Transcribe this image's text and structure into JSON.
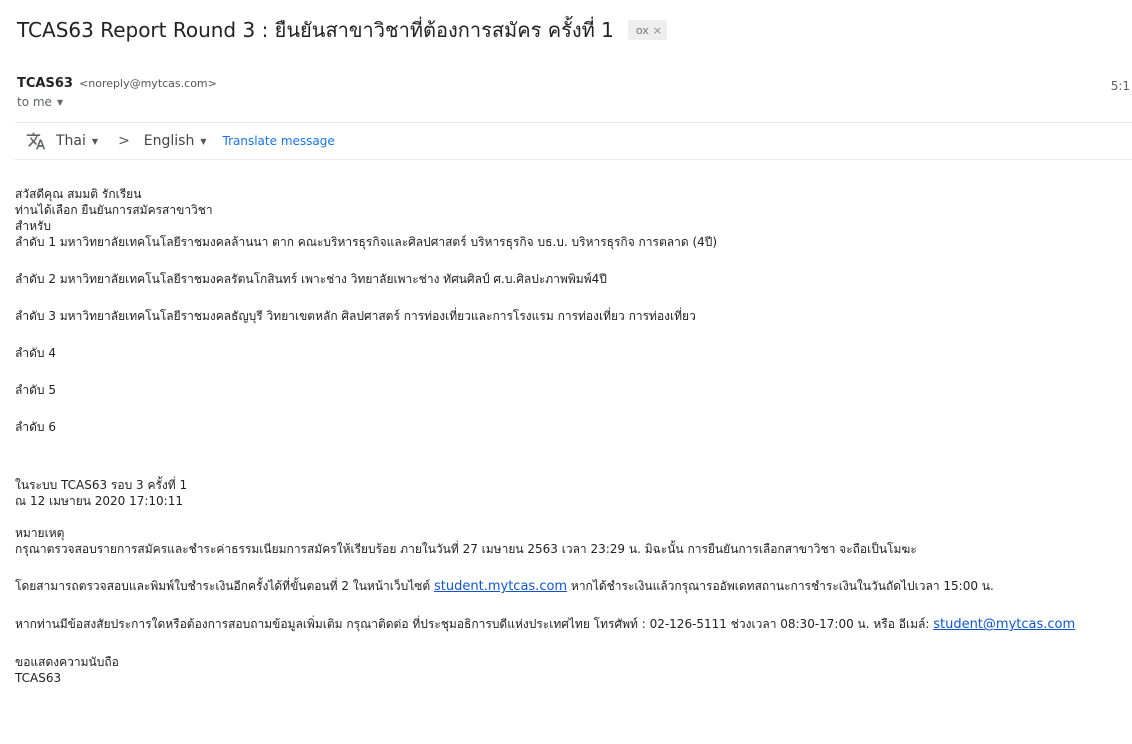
{
  "subject": {
    "title": "TCAS63 Report Round 3 : ยืนยันสาขาวิชาที่ต้องการสมัคร ครั้งที่ 1",
    "label_chip": "ox",
    "label_chip_close": "×"
  },
  "sender": {
    "name": "TCAS63",
    "email": "<noreply@mytcas.com>",
    "to": "to me",
    "time": "5:1"
  },
  "translate": {
    "icon": "translate-icon",
    "from_lang": "Thai",
    "arrow": ">",
    "to_lang": "English",
    "action": "Translate message"
  },
  "body": {
    "greeting": "สวัสดีคุณ สมมติ รักเรียน",
    "intro": "ท่านได้เลือก ยืนยันการสมัครสาขาวิชา",
    "for_label": "สำหรับ",
    "rank1": "ลำดับ 1 มหาวิทยาลัยเทคโนโลยีราชมงคลล้านนา ตาก คณะบริหารธุรกิจและศิลปศาสตร์ บริหารธุรกิจ บธ.บ. บริหารธุรกิจ การตลาด (4ปี)",
    "rank2": "ลำดับ 2 มหาวิทยาลัยเทคโนโลยีราชมงคลรัตนโกสินทร์ เพาะช่าง วิทยาลัยเพาะช่าง ทัศนศิลป์ ศ.บ.ศิลปะภาพพิมพ์4ปี",
    "rank3": "ลำดับ 3 มหาวิทยาลัยเทคโนโลยีราชมงคลธัญบุรี วิทยาเขตหลัก ศิลปศาสตร์ การท่องเที่ยวและการโรงแรม การท่องเที่ยว การท่องเที่ยว",
    "rank4": "ลำดับ 4",
    "rank5": "ลำดับ 5",
    "rank6": "ลำดับ 6",
    "system_line": "ในระบบ TCAS63 รอบ 3 ครั้งที่ 1",
    "date_line": "ณ 12 เมษายน 2020 17:10:11",
    "note_heading": "หมายเหตุ",
    "note_text": "กรุณาตรวจสอบรายการสมัครและชำระค่าธรรมเนียมการสมัครให้เรียบร้อย ภายในวันที่ 27 เมษายน 2563 เวลา 23:29 น. มิฉะนั้น การยืนยันการเลือกสาขาวิชา จะถือเป็นโมฆะ",
    "payment_prefix": "โดยสามารถตรวจสอบและพิมพ์ใบชำระเงินอีกครั้งได้ที่ขั้นตอนที่ 2 ในหน้าเว็บไซต์ ",
    "payment_link": "student.mytcas.com",
    "payment_suffix": " หากได้ชำระเงินแล้วกรุณารออัพเดทสถานะการชำระเงินในวันถัดไปเวลา 15:00 น.",
    "contact_prefix": "หากท่านมีข้อสงสัยประการใดหรือต้องการสอบถามข้อมูลเพิ่มเติม กรุณาติดต่อ ที่ประชุมอธิการบดีแห่งประเทศไทย โทรศัพท์ : 02-126-5111 ช่วงเวลา 08:30-17:00 น. หรือ อีเมล์: ",
    "contact_email": "student@mytcas.com",
    "thanks": "ขอแสดงความนับถือ",
    "signature": "TCAS63"
  }
}
